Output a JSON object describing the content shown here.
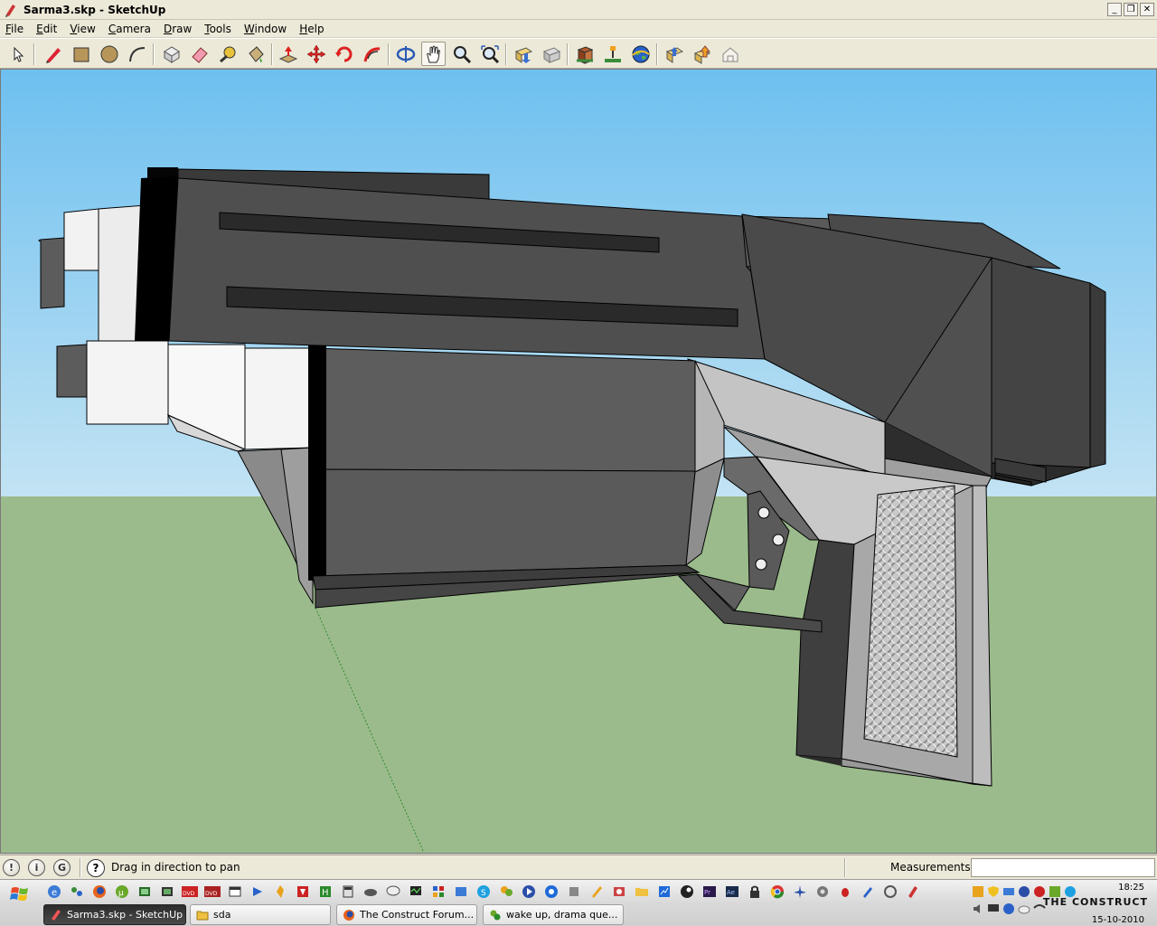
{
  "window": {
    "title": "Sarma3.skp - SketchUp"
  },
  "menu": {
    "items": [
      {
        "label": "File",
        "key": "F",
        "rest": "ile"
      },
      {
        "label": "Edit",
        "key": "E",
        "rest": "dit"
      },
      {
        "label": "View",
        "key": "V",
        "rest": "iew"
      },
      {
        "label": "Camera",
        "key": "C",
        "rest": "amera"
      },
      {
        "label": "Draw",
        "key": "D",
        "rest": "raw"
      },
      {
        "label": "Tools",
        "key": "T",
        "rest": "ools"
      },
      {
        "label": "Window",
        "key": "W",
        "rest": "indow"
      },
      {
        "label": "Help",
        "key": "H",
        "rest": "elp"
      }
    ]
  },
  "toolbar": {
    "tools": [
      "select",
      "pencil",
      "rectangle",
      "circle",
      "arc",
      "make-component",
      "eraser",
      "tape-measure",
      "paint-bucket",
      "push-pull",
      "move",
      "rotate",
      "follow-me",
      "orbit",
      "pan",
      "zoom",
      "zoom-extents",
      "get-models",
      "share-model",
      "get-photo-texture",
      "place-model",
      "google-earth",
      "toggle-terrain",
      "preview-in-google-earth",
      "extension"
    ],
    "active_tool": "pan"
  },
  "viewport": {
    "sky_color": "#7fc3ee",
    "ground_color": "#9bbb8c"
  },
  "status": {
    "hint": "Drag in direction to pan",
    "measurements_label": "Measurements",
    "measurements_value": ""
  },
  "taskbar": {
    "windows": [
      {
        "label": "Sarma3.skp - SketchUp",
        "active": true
      },
      {
        "label": "sda",
        "active": false
      },
      {
        "label": "The Construct Forum...",
        "active": false
      },
      {
        "label": "wake up, drama que...",
        "active": false
      }
    ],
    "watermark": "THE CONSTRUCT",
    "clock_time": "18:25",
    "clock_date": "15-10-2010"
  }
}
